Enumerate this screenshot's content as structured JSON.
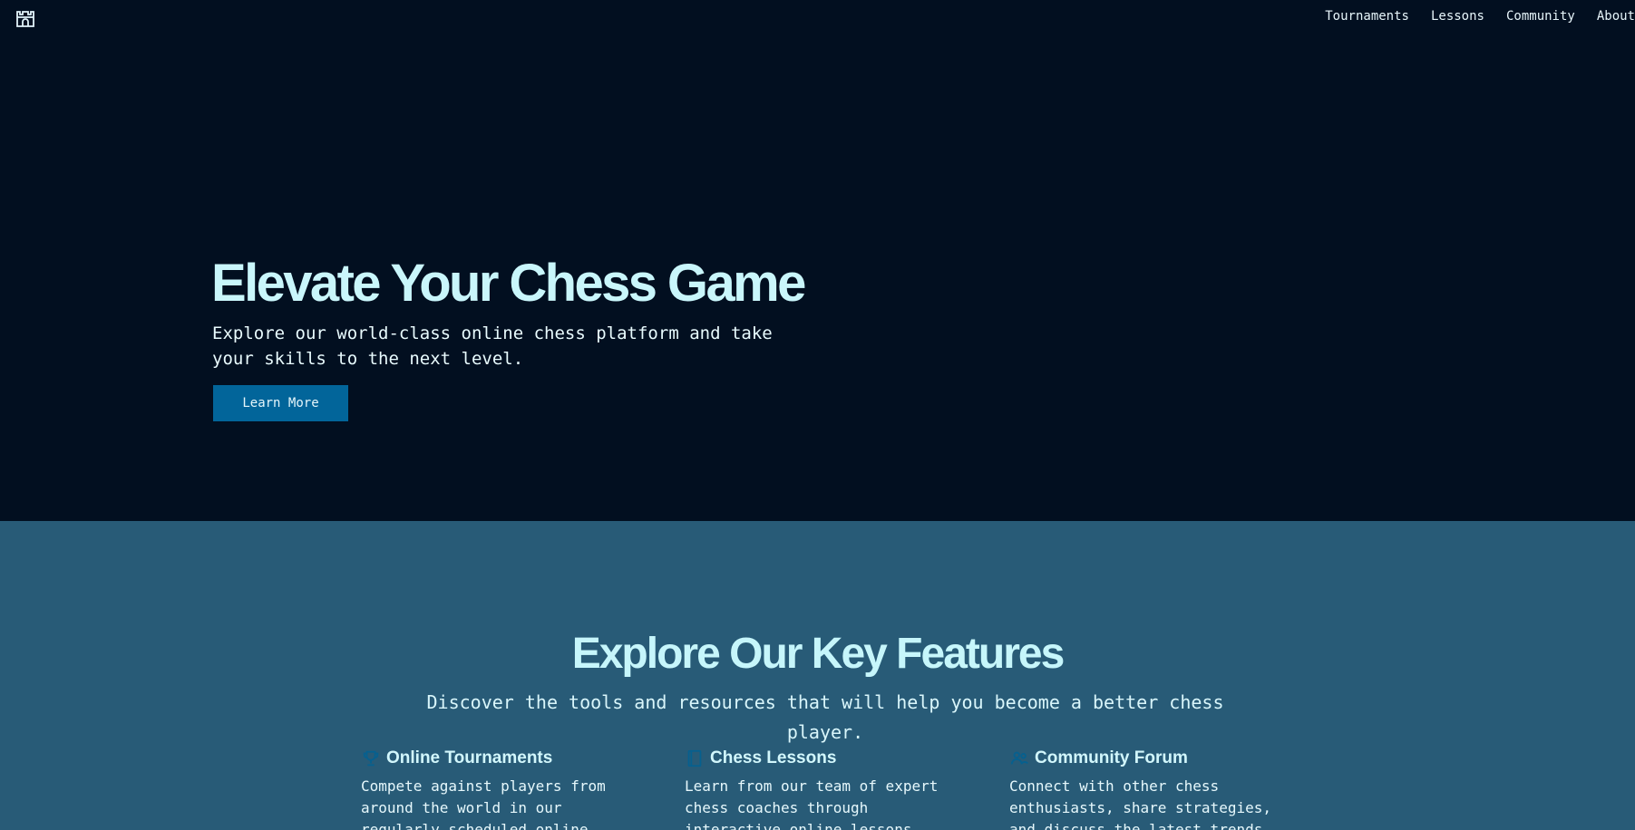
{
  "header": {
    "logo_icon": "castle-icon",
    "nav": [
      {
        "label": "Tournaments"
      },
      {
        "label": "Lessons"
      },
      {
        "label": "Community"
      },
      {
        "label": "About"
      }
    ]
  },
  "hero": {
    "title": "Elevate Your Chess Game",
    "subtitle": "Explore our world-class online chess platform and take your skills to the next level.",
    "cta_label": "Learn More"
  },
  "features": {
    "title": "Explore Our Key Features",
    "subtitle": "Discover the tools and resources that will help you become a better chess player.",
    "items": [
      {
        "icon": "trophy-icon",
        "title": "Online Tournaments",
        "text": "Compete against players from around the world in our regularly scheduled online"
      },
      {
        "icon": "book-icon",
        "title": "Chess Lessons",
        "text": "Learn from our team of expert chess coaches through interactive online lessons"
      },
      {
        "icon": "users-icon",
        "title": "Community Forum",
        "text": "Connect with other chess enthusiasts, share strategies, and discuss the latest trends"
      }
    ]
  },
  "colors": {
    "hero_bg": "#020f20",
    "features_bg": "#285b77",
    "accent_button": "#02659a",
    "heading": "#c9f6fb"
  }
}
